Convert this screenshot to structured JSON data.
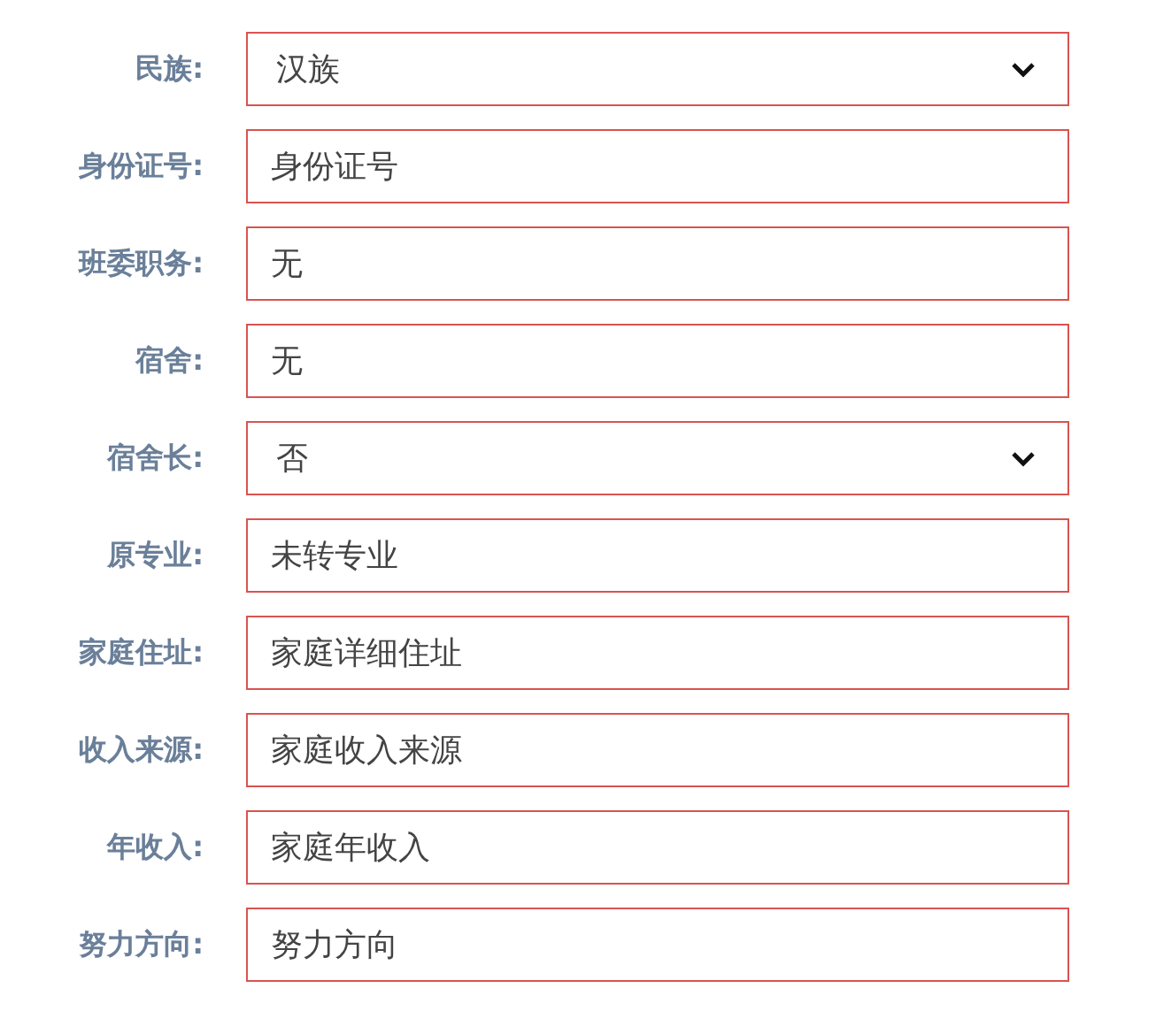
{
  "fields": [
    {
      "label": "民族:",
      "kind": "select",
      "value": "汉族"
    },
    {
      "label": "身份证号:",
      "kind": "input",
      "value": "身份证号"
    },
    {
      "label": "班委职务:",
      "kind": "input",
      "value": "无"
    },
    {
      "label": "宿舍:",
      "kind": "input",
      "value": "无"
    },
    {
      "label": "宿舍长:",
      "kind": "select",
      "value": "否"
    },
    {
      "label": "原专业:",
      "kind": "input",
      "value": "未转专业"
    },
    {
      "label": "家庭住址:",
      "kind": "input",
      "value": "家庭详细住址"
    },
    {
      "label": "收入来源:",
      "kind": "input",
      "value": "家庭收入来源"
    },
    {
      "label": "年收入:",
      "kind": "input",
      "value": "家庭年收入"
    },
    {
      "label": "努力方向:",
      "kind": "input",
      "value": "努力方向"
    }
  ]
}
